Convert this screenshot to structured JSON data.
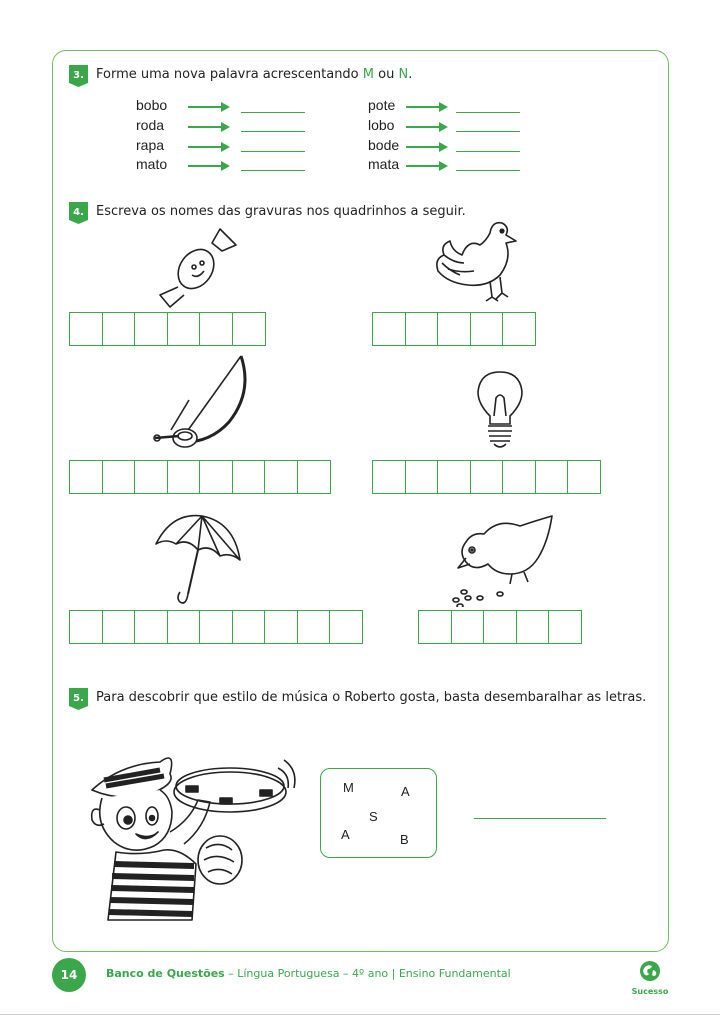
{
  "q3": {
    "number": "3.",
    "text_before": "Forme uma nova palavra acrescentando ",
    "letter_m": "M",
    "text_mid": " ou ",
    "letter_n": "N",
    "text_after": ".",
    "left_words": [
      "bobo",
      "roda",
      "rapa",
      "mato"
    ],
    "right_words": [
      "pote",
      "lobo",
      "bode",
      "mata"
    ]
  },
  "q4": {
    "number": "4.",
    "text": "Escreva os nomes das gravuras nos quadrinhos a seguir.",
    "pictures": [
      {
        "icon": "candy-icon",
        "boxes": 6
      },
      {
        "icon": "hen-icon",
        "boxes": 5
      },
      {
        "icon": "berimbau-icon",
        "boxes": 8
      },
      {
        "icon": "light-bulb-icon",
        "boxes": 7
      },
      {
        "icon": "umbrella-icon",
        "boxes": 9
      },
      {
        "icon": "chick-icon",
        "boxes": 5
      }
    ]
  },
  "q5": {
    "number": "5.",
    "text": "Para descobrir que estilo de música o Roberto gosta, basta desembaralhar as letras.",
    "letters": [
      "M",
      "A",
      "S",
      "A",
      "B"
    ],
    "icon": "boy-with-tambourine-icon"
  },
  "footer": {
    "page_number": "14",
    "title_bold": "Banco de Questões",
    "title_rest": " – Língua Portuguesa – 4º ano | Ensino Fundamental",
    "brand": "Sucesso"
  },
  "colors": {
    "accent": "#3aa84a",
    "frame": "#6fbf5a"
  }
}
